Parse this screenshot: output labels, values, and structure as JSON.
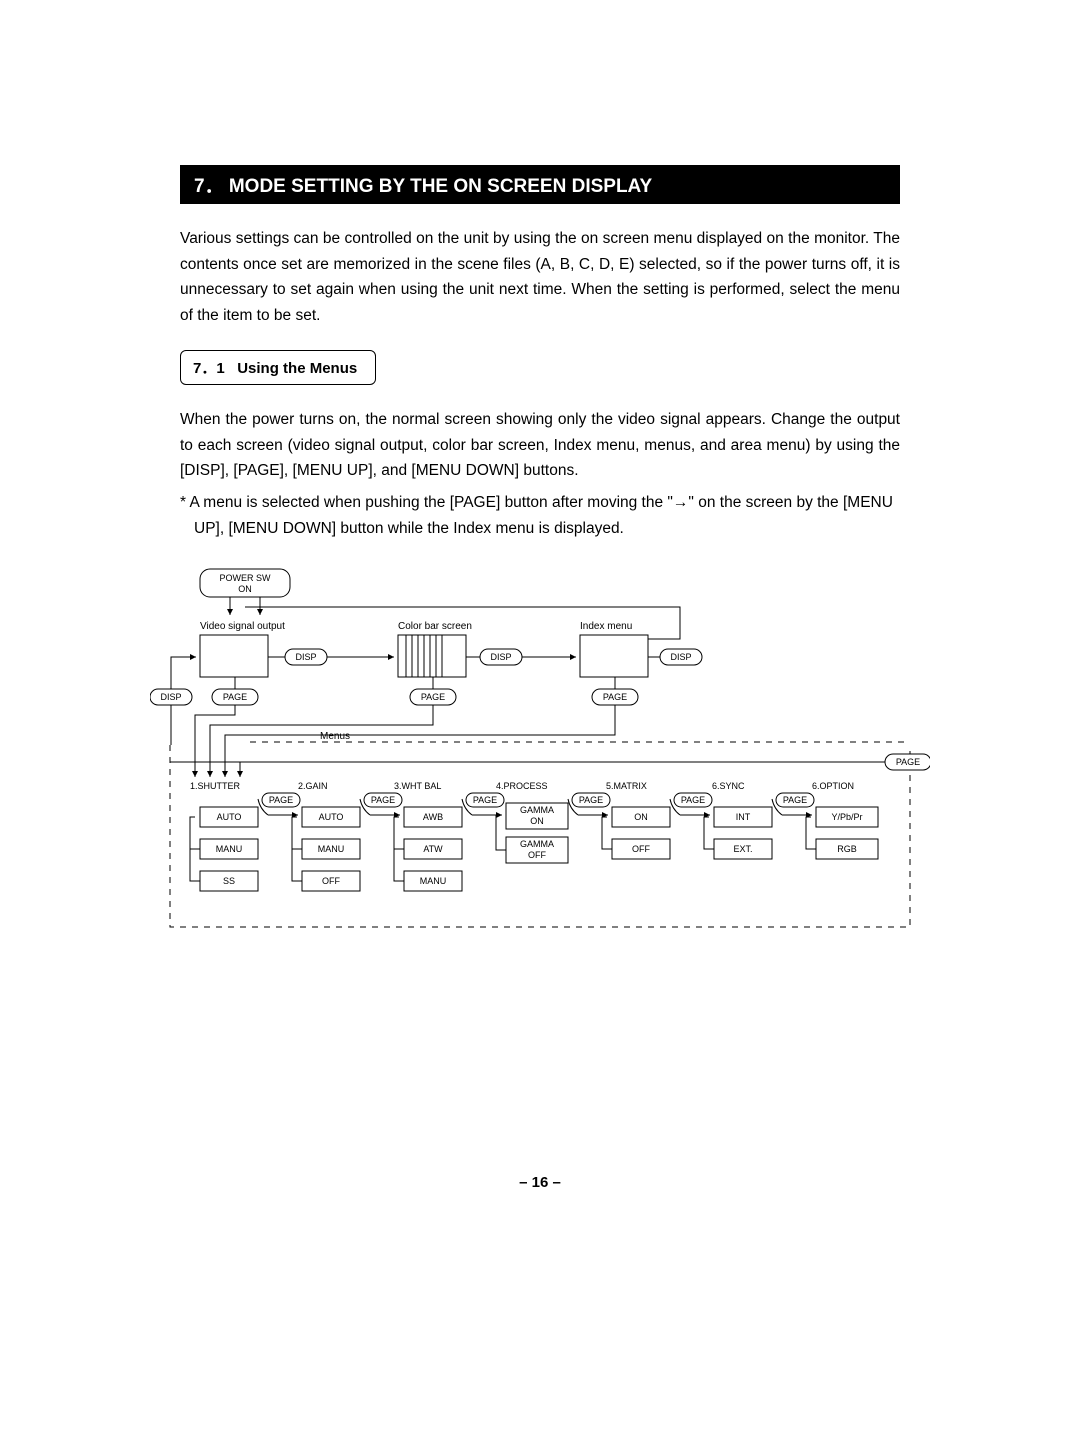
{
  "section": {
    "number": "7．",
    "title": "MODE SETTING BY THE ON SCREEN DISPLAY"
  },
  "para1": "Various settings can be controlled on the unit by using the on screen menu displayed on the monitor. The contents once set are memorized in the scene files (A, B, C, D, E) selected, so if the power turns off, it is unnecessary to set again when using the unit next time. When the setting is performed, select the menu of the item to be set.",
  "sub": {
    "number": "7．1",
    "title": "Using the Menus"
  },
  "para2": "When the power turns on, the normal screen showing only the video signal appears. Change the output to each screen (video signal output, color bar screen, Index menu, menus, and area menu) by using the [DISP], [PAGE], [MENU UP], and [MENU DOWN] buttons.",
  "note": {
    "star": "*",
    "line1": "A menu is selected when pushing the [PAGE] button after moving the \"→\" on the screen by the [MENU",
    "line2": "UP], [MENU DOWN] button while the Index menu is displayed."
  },
  "diagram": {
    "power": "POWER SW\nON",
    "video": "Video signal output",
    "colorbar": "Color bar screen",
    "index": "Index menu",
    "disp": "DISP",
    "page": "PAGE",
    "menus": "Menus",
    "cols": [
      {
        "head": "1.SHUTTER",
        "items": [
          "AUTO",
          "MANU",
          "SS"
        ]
      },
      {
        "head": "2.GAIN",
        "items": [
          "AUTO",
          "MANU",
          "OFF"
        ]
      },
      {
        "head": "3.WHT BAL",
        "items": [
          "AWB",
          "ATW",
          "MANU"
        ]
      },
      {
        "head": "4.PROCESS",
        "items": [
          "GAMMA\nON",
          "GAMMA\nOFF"
        ]
      },
      {
        "head": "5.MATRIX",
        "items": [
          "ON",
          "OFF"
        ]
      },
      {
        "head": "6.SYNC",
        "items": [
          "INT",
          "EXT."
        ]
      },
      {
        "head": "6.OPTION",
        "items": [
          "Y/Pb/Pr",
          "RGB"
        ]
      }
    ]
  },
  "pagenum": "– 16 –"
}
